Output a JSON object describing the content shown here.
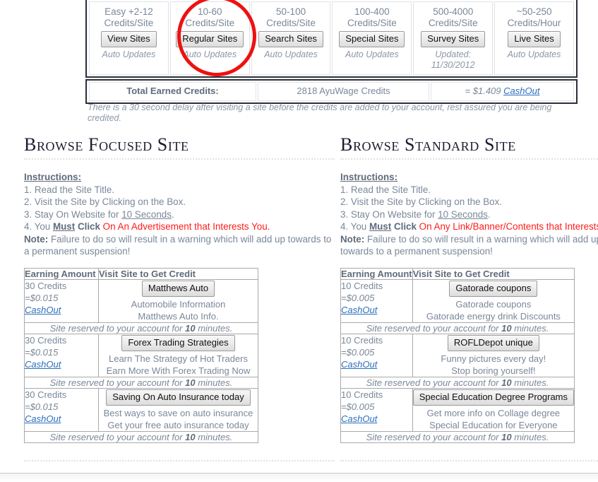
{
  "nav": {
    "cards": [
      {
        "rate": "Easy +2-12",
        "unit": "Credits/Site",
        "button": "View Sites",
        "note": "Auto Updates"
      },
      {
        "rate": "10-60",
        "unit": "Credits/Site",
        "button": "Regular Sites",
        "note": "Auto Updates"
      },
      {
        "rate": "50-100",
        "unit": "Credits/Site",
        "button": "Search Sites",
        "note": "Auto Updates"
      },
      {
        "rate": "100-400",
        "unit": "Credits/Site",
        "button": "Special Sites",
        "note": "Auto Updates"
      },
      {
        "rate": "500-4000",
        "unit": "Credits/Site",
        "button": "Survey Sites",
        "note": "Updated:",
        "note2": "11/30/2012"
      },
      {
        "rate": "~50-250",
        "unit": "Credits/Hour",
        "button": "Live Sites",
        "note": "Auto Updates"
      }
    ],
    "highlight_color": "#ee1111",
    "highlighted_card": "Regular Sites"
  },
  "credits": {
    "label": "Total Earned Credits:",
    "amount": "2818 AyuWage Credits",
    "cash_equals": "= $1.409",
    "cash_link": "CashOut",
    "delay_note": "There is a 30 second delay after visiting a site before the credits are added to your account, rest assured you are being credited."
  },
  "columns": [
    {
      "title": "Browse Focused Site",
      "instructions": {
        "heading": "Instructions:",
        "step1": "1. Read the Site Title.",
        "step2": "2. Visit the Site by Clicking on the Box.",
        "step3_pre": "3. Stay On Website for ",
        "step3_u": "10 Seconds",
        "step3_post": ".",
        "step4_pre": "4. You ",
        "step4_must": "Must",
        "step4_click": " Click ",
        "step4_red": "On An Advertisement that Interests You.",
        "note_label": "Note:",
        "note_text": " Failure to do so will result in a warning which will add up towards to a permanent suspension!"
      },
      "table": {
        "col_amount": "Earning Amount",
        "col_site": "Visit Site to Get Credit",
        "reserved_pre": "Site reserved to your account for ",
        "reserved_num": "10",
        "reserved_post": " minutes.",
        "rows": [
          {
            "credits": "30 Credits",
            "dollars": "=$0.015",
            "cashout": "CashOut",
            "site_button": "Matthews Auto",
            "desc1": "Automobile Information",
            "desc2": "Matthews Auto Info."
          },
          {
            "credits": "30 Credits",
            "dollars": "=$0.015",
            "cashout": "CashOut",
            "site_button": "Forex Trading Strategies",
            "desc1": "Learn The Strategy of Hot Traders",
            "desc2": "Earn More With Forex Trading Now"
          },
          {
            "credits": "30 Credits",
            "dollars": "=$0.015",
            "cashout": "CashOut",
            "site_button": "Saving On Auto Insurance today",
            "desc1": "Best ways to save on auto insurance",
            "desc2": "Get your free auto insurance today"
          }
        ]
      }
    },
    {
      "title": "Browse Standard Site",
      "instructions": {
        "heading": "Instructions:",
        "step1": "1. Read the Site Title.",
        "step2": "2. Visit the Site by Clicking on the Box.",
        "step3_pre": "3. Stay On Website for ",
        "step3_u": "10 Seconds",
        "step3_post": ".",
        "step4_pre": "4. You ",
        "step4_must": "Must",
        "step4_click": " Click ",
        "step4_red": "On Any Link/Banner/Contents that Interests You.",
        "note_label": "Note:",
        "note_text": " Failure to do so will result in a warning which will add up towards to a permanent suspension!"
      },
      "table": {
        "col_amount": "Earning Amount",
        "col_site": "Visit Site to Get Credit",
        "reserved_pre": "Site reserved to your account for ",
        "reserved_num": "10",
        "reserved_post": " minutes.",
        "rows": [
          {
            "credits": "10 Credits",
            "dollars": "=$0.005",
            "cashout": "CashOut",
            "site_button": "Gatorade coupons",
            "desc1": "Gatorade coupons",
            "desc2": "Gatorade energy drink Discounts"
          },
          {
            "credits": "10 Credits",
            "dollars": "=$0.005",
            "cashout": "CashOut",
            "site_button": "ROFLDepot unique",
            "desc1": "Funny pictures every day!",
            "desc2": "Stop boring yourself!"
          },
          {
            "credits": "10 Credits",
            "dollars": "=$0.005",
            "cashout": "CashOut",
            "site_button": "Special Education Degree Programs",
            "desc1": "Get more info on Collage degree",
            "desc2": "Special Education for Everyone"
          }
        ]
      }
    }
  ],
  "colors": {
    "body_text": "#7a8899",
    "link": "#2a6ebb",
    "accent_red": "#ff1a1a",
    "annotation_red": "#ee1111",
    "heading": "#1b1b30"
  }
}
